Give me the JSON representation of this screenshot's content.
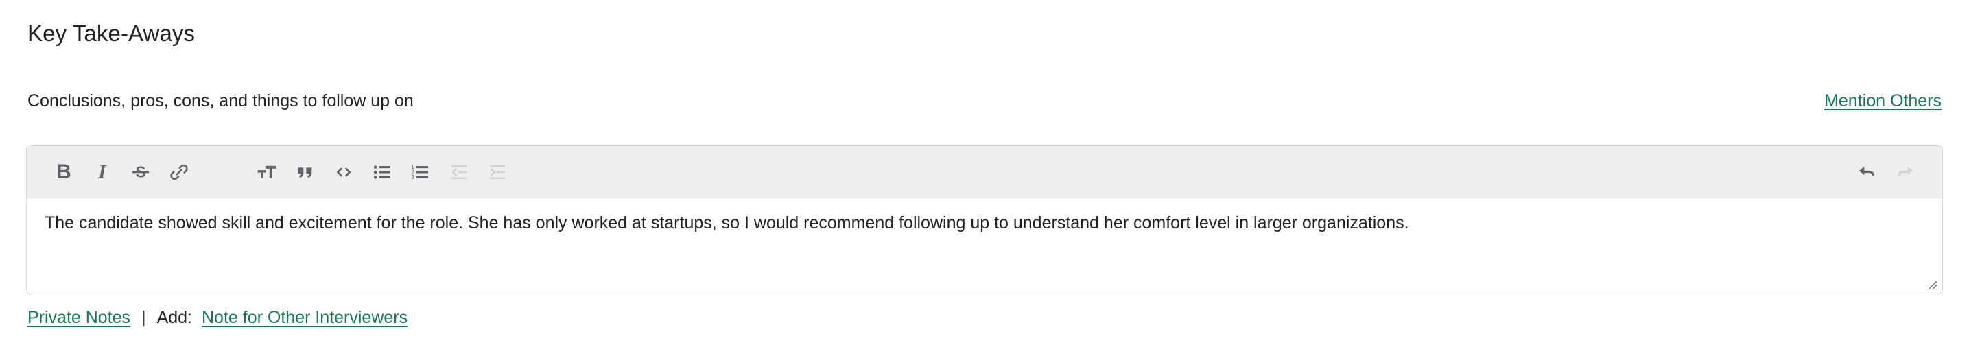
{
  "section": {
    "title": "Key Take-Aways",
    "subtitle": "Conclusions, pros, cons, and things to follow up on",
    "mention_link": "Mention Others"
  },
  "colors": {
    "link_green": "#13794f",
    "toolbar_bg": "#eeeeee",
    "icon_enabled": "#5f6368",
    "icon_disabled": "#d2d2d2",
    "border": "#d6d6d6",
    "text": "#202124"
  },
  "toolbar": {
    "groups": [
      {
        "buttons": [
          {
            "name": "bold-icon",
            "label": "B",
            "enabled": true
          },
          {
            "name": "italic-icon",
            "label": "I",
            "enabled": true
          },
          {
            "name": "strikethrough-icon",
            "label": "S",
            "enabled": true
          },
          {
            "name": "link-icon",
            "label": "Link",
            "enabled": true
          }
        ]
      },
      {
        "buttons": [
          {
            "name": "text-size-icon",
            "label": "Text size",
            "enabled": true
          },
          {
            "name": "blockquote-icon",
            "label": "Quote",
            "enabled": true
          },
          {
            "name": "code-icon",
            "label": "Code",
            "enabled": true
          },
          {
            "name": "bulleted-list-icon",
            "label": "Bulleted list",
            "enabled": true
          },
          {
            "name": "numbered-list-icon",
            "label": "Numbered list",
            "enabled": true
          },
          {
            "name": "outdent-icon",
            "label": "Decrease indent",
            "enabled": false
          },
          {
            "name": "indent-icon",
            "label": "Increase indent",
            "enabled": false
          }
        ]
      }
    ],
    "history": [
      {
        "name": "undo-icon",
        "label": "Undo",
        "enabled": true
      },
      {
        "name": "redo-icon",
        "label": "Redo",
        "enabled": false
      }
    ]
  },
  "editor": {
    "value": "The candidate showed skill and excitement for the role. She has only worked at startups, so I would recommend following up to understand her comfort level in larger organizations.",
    "placeholder": "Conclusions, pros, cons, and things to follow up on"
  },
  "footer": {
    "private_notes": "Private Notes",
    "separator": "|",
    "add_label": "Add:",
    "add_note_link": "Note for Other Interviewers"
  }
}
